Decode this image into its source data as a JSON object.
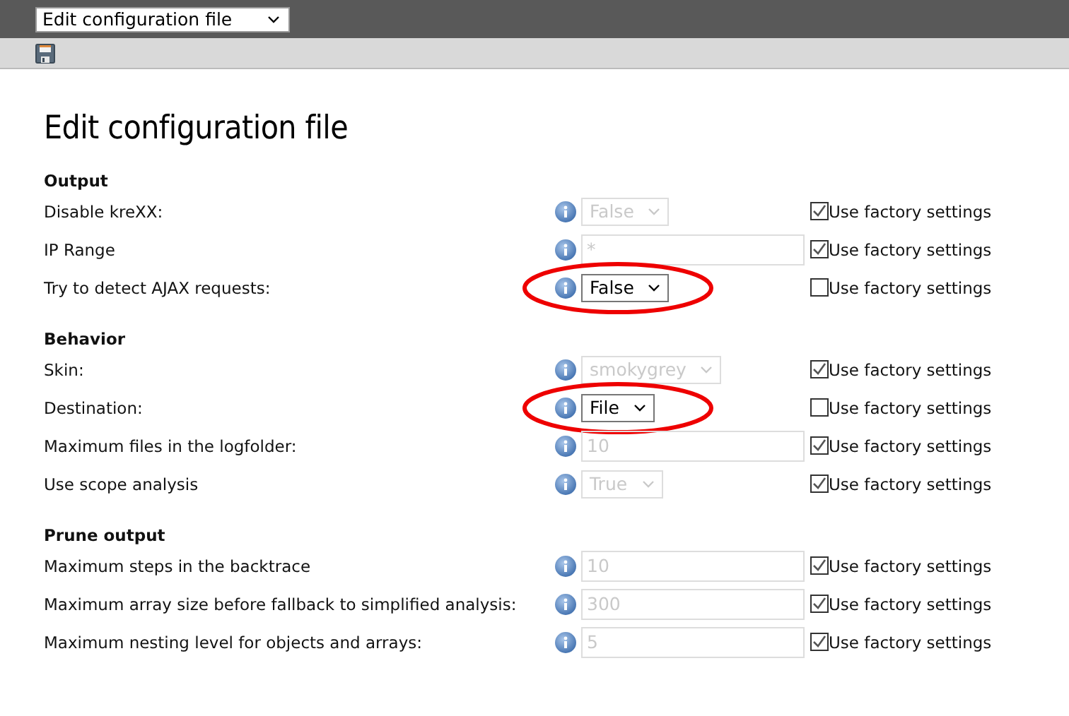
{
  "top_bar": {
    "file_select": {
      "value": "Edit configuration file"
    }
  },
  "title": "Edit configuration file",
  "sections": [
    {
      "heading": "Output",
      "rows": [
        {
          "label": "Disable kreXX:",
          "control": {
            "kind": "select",
            "value": "False",
            "disabled": true
          },
          "factory": {
            "label": "Use factory settings",
            "checked": true
          },
          "highlighted": false
        },
        {
          "label": "IP Range",
          "control": {
            "kind": "text",
            "value": "*",
            "disabled": true
          },
          "factory": {
            "label": "Use factory settings",
            "checked": true
          },
          "highlighted": false
        },
        {
          "label": "Try to detect AJAX requests:",
          "control": {
            "kind": "select",
            "value": "False",
            "disabled": false
          },
          "factory": {
            "label": "Use factory settings",
            "checked": false
          },
          "highlighted": true
        }
      ]
    },
    {
      "heading": "Behavior",
      "rows": [
        {
          "label": "Skin:",
          "control": {
            "kind": "select",
            "value": "smokygrey",
            "disabled": true
          },
          "factory": {
            "label": "Use factory settings",
            "checked": true
          },
          "highlighted": false
        },
        {
          "label": "Destination:",
          "control": {
            "kind": "select",
            "value": "File",
            "disabled": false
          },
          "factory": {
            "label": "Use factory settings",
            "checked": false
          },
          "highlighted": true
        },
        {
          "label": "Maximum files in the logfolder:",
          "control": {
            "kind": "text",
            "value": "10",
            "disabled": true
          },
          "factory": {
            "label": "Use factory settings",
            "checked": true
          },
          "highlighted": false
        },
        {
          "label": "Use scope analysis",
          "control": {
            "kind": "select",
            "value": "True",
            "disabled": true
          },
          "factory": {
            "label": "Use factory settings",
            "checked": true
          },
          "highlighted": false
        }
      ]
    },
    {
      "heading": "Prune output",
      "rows": [
        {
          "label": "Maximum steps in the backtrace",
          "control": {
            "kind": "text",
            "value": "10",
            "disabled": true
          },
          "factory": {
            "label": "Use factory settings",
            "checked": true
          },
          "highlighted": false
        },
        {
          "label": "Maximum array size before fallback to simplified analysis:",
          "control": {
            "kind": "text",
            "value": "300",
            "disabled": true
          },
          "factory": {
            "label": "Use factory settings",
            "checked": true
          },
          "highlighted": false
        },
        {
          "label": "Maximum nesting level for objects and arrays:",
          "control": {
            "kind": "text",
            "value": "5",
            "disabled": true
          },
          "factory": {
            "label": "Use factory settings",
            "checked": true
          },
          "highlighted": false
        }
      ]
    }
  ]
}
